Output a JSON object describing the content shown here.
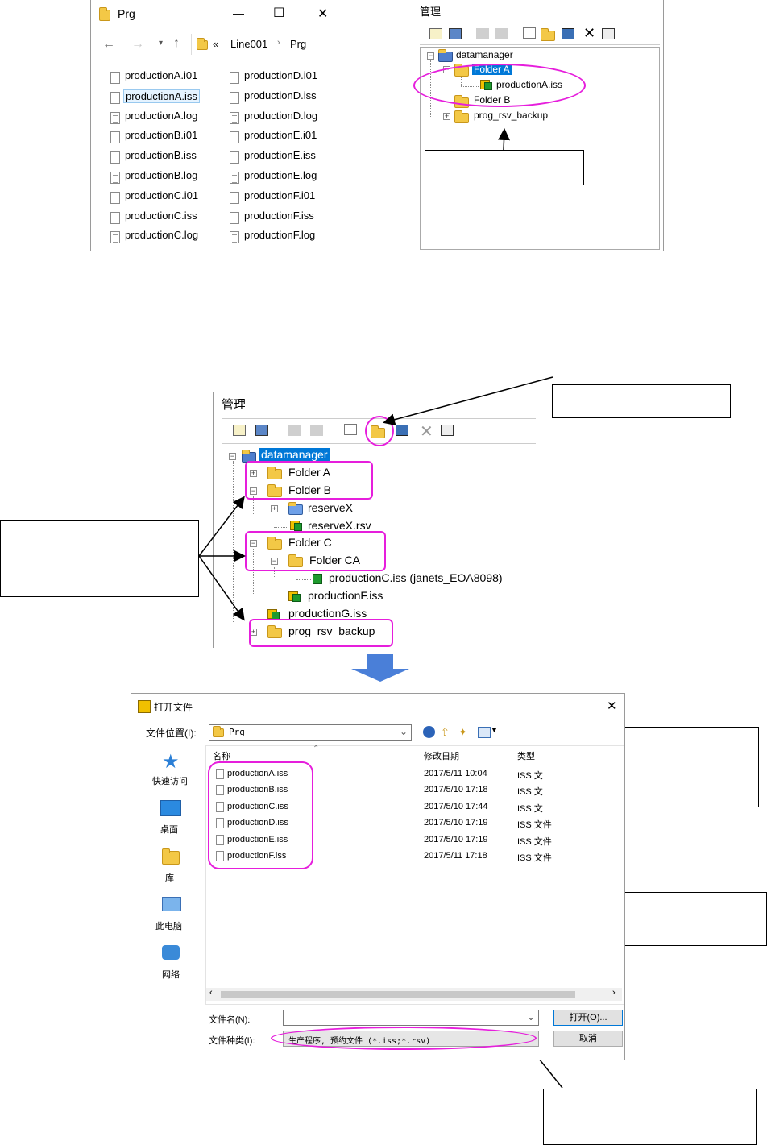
{
  "explorer": {
    "title": "Prg",
    "minimize": "—",
    "maximize": "☐",
    "close": "✕",
    "path_sep": "«",
    "path": [
      "Line001",
      "Prg"
    ],
    "col1": [
      "productionA.i01",
      "productionA.iss",
      "productionA.log",
      "productionB.i01",
      "productionB.iss",
      "productionB.log",
      "productionC.i01",
      "productionC.iss",
      "productionC.log"
    ],
    "col2": [
      "productionD.i01",
      "productionD.iss",
      "productionD.log",
      "productionE.i01",
      "productionE.iss",
      "productionE.log",
      "productionF.i01",
      "productionF.iss",
      "productionF.log"
    ]
  },
  "manager1": {
    "title": "管理",
    "root": "datamanager",
    "folder_a": "Folder A",
    "file_a": "productionA.iss",
    "folder_b": "Folder B",
    "backup": "prog_rsv_backup"
  },
  "manager2": {
    "title": "管理",
    "root": "datamanager",
    "folder_a": "Folder A",
    "folder_b": "Folder B",
    "reserve": "reserveX",
    "reserve_rsv": "reserveX.rsv",
    "folder_c": "Folder C",
    "folder_ca": "Folder CA",
    "file_c": "productionC.iss (janets_EOA8098)",
    "file_f": "productionF.iss",
    "file_g": "productionG.iss",
    "backup": "prog_rsv_backup"
  },
  "dialog": {
    "title": "打开文件",
    "location_label": "文件位置(I):",
    "location_value": "Prg",
    "close": "✕",
    "col_name": "名称",
    "col_date": "修改日期",
    "col_type": "类型",
    "places": [
      "快速访问",
      "桌面",
      "库",
      "此电脑",
      "网络"
    ],
    "files": [
      {
        "name": "productionA.iss",
        "date": "2017/5/11 10:04",
        "type": "ISS 文"
      },
      {
        "name": "productionB.iss",
        "date": "2017/5/10 17:18",
        "type": "ISS 文"
      },
      {
        "name": "productionC.iss",
        "date": "2017/5/10 17:44",
        "type": "ISS 文"
      },
      {
        "name": "productionD.iss",
        "date": "2017/5/10 17:19",
        "type": "ISS 文件"
      },
      {
        "name": "productionE.iss",
        "date": "2017/5/10 17:19",
        "type": "ISS 文件"
      },
      {
        "name": "productionF.iss",
        "date": "2017/5/11 17:18",
        "type": "ISS 文件"
      }
    ],
    "filename_label": "文件名(N):",
    "filetype_label": "文件种类(I):",
    "filetype_value": "生产程序, 预约文件 (*.iss;*.rsv)",
    "open_button": "打开(O)...",
    "cancel_button": "取消"
  },
  "colors": {
    "highlight": "#e61edc",
    "selection": "#0078d7",
    "arrow": "#4a7fd8"
  }
}
